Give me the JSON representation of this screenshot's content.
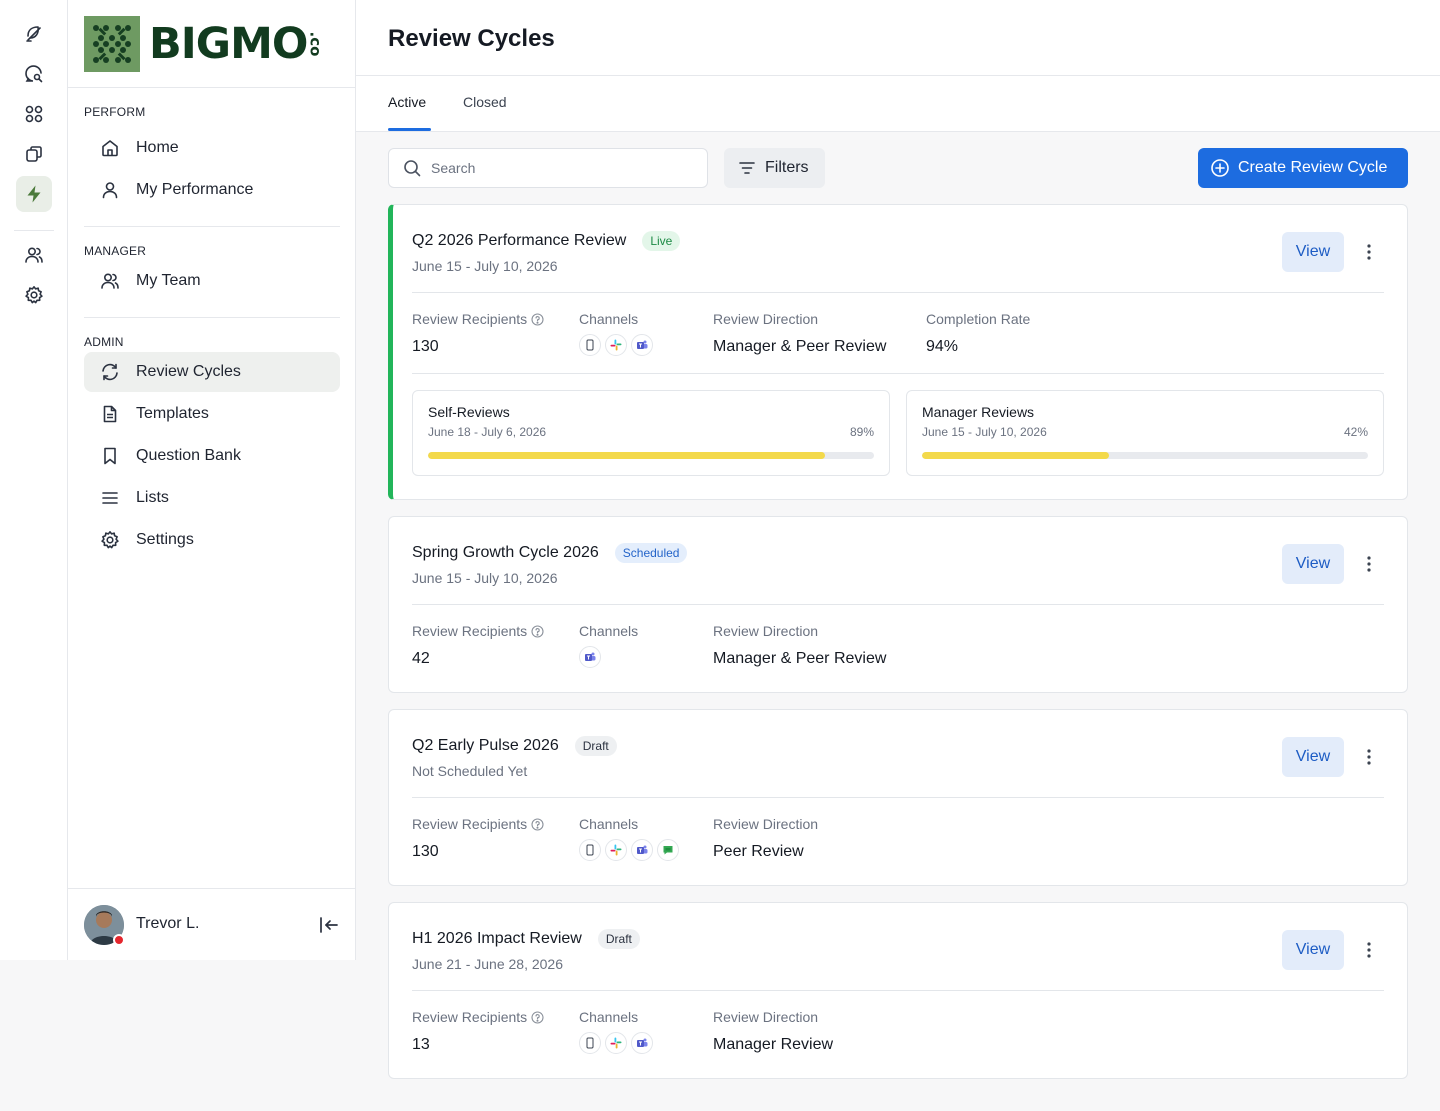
{
  "brand": {
    "name": "BIGMO",
    "suffix": ".co"
  },
  "sidebar": {
    "sections": [
      {
        "label": "PERFORM",
        "items": [
          {
            "label": "Home",
            "icon": "home-icon"
          },
          {
            "label": "My Performance",
            "icon": "user-icon"
          }
        ]
      },
      {
        "label": "MANAGER",
        "items": [
          {
            "label": "My Team",
            "icon": "users-icon"
          }
        ]
      },
      {
        "label": "ADMIN",
        "items": [
          {
            "label": "Review Cycles",
            "icon": "refresh-icon",
            "active": true
          },
          {
            "label": "Templates",
            "icon": "document-icon"
          },
          {
            "label": "Question Bank",
            "icon": "bookmark-icon"
          },
          {
            "label": "Lists",
            "icon": "list-icon"
          },
          {
            "label": "Settings",
            "icon": "gear-icon"
          }
        ]
      }
    ],
    "user": {
      "name": "Trevor L.",
      "status_color": "#e5262d"
    }
  },
  "header": {
    "title": "Review Cycles",
    "tabs": [
      {
        "label": "Active",
        "active": true
      },
      {
        "label": "Closed",
        "active": false
      }
    ]
  },
  "toolbar": {
    "search_placeholder": "Search",
    "filters_label": "Filters",
    "create_label": "Create Review Cycle"
  },
  "colors": {
    "accent": "#1d6ce0",
    "live": "#22b55a",
    "brand_green": "#123b1f",
    "progress": "#f3d94b"
  },
  "cycles": [
    {
      "title": "Q2 2026 Performance Review",
      "status": "Live",
      "dates": "June 15 - July 10, 2026",
      "view_label": "View",
      "recipients_label": "Review Recipients",
      "recipients": "130",
      "channels_label": "Channels",
      "channels": [
        "mobile",
        "slack",
        "teams"
      ],
      "direction_label": "Review Direction",
      "direction": "Manager & Peer Review",
      "completion_label": "Completion Rate",
      "completion": "94%",
      "phases": [
        {
          "title": "Self-Reviews",
          "dates": "June 18 - July 6, 2026",
          "percent_label": "89%",
          "progress": 0.89
        },
        {
          "title": "Manager Reviews",
          "dates": "June 15 - July 10, 2026",
          "percent_label": "42%",
          "progress": 0.42
        }
      ]
    },
    {
      "title": "Spring Growth Cycle 2026",
      "status": "Scheduled",
      "dates": "June 15 - July 10, 2026",
      "view_label": "View",
      "recipients_label": "Review Recipients",
      "recipients": "42",
      "channels_label": "Channels",
      "channels": [
        "teams"
      ],
      "direction_label": "Review Direction",
      "direction": "Manager & Peer Review"
    },
    {
      "title": "Q2 Early Pulse 2026",
      "status": "Draft",
      "dates": "Not Scheduled Yet",
      "view_label": "View",
      "recipients_label": "Review Recipients",
      "recipients": "130",
      "channels_label": "Channels",
      "channels": [
        "mobile",
        "slack",
        "teams",
        "google-chat"
      ],
      "direction_label": "Review Direction",
      "direction": "Peer Review"
    },
    {
      "title": "H1 2026 Impact Review",
      "status": "Draft",
      "dates": "June 21 - June 28, 2026",
      "view_label": "View",
      "recipients_label": "Review Recipients",
      "recipients": "13",
      "channels_label": "Channels",
      "channels": [
        "mobile",
        "slack",
        "teams"
      ],
      "direction_label": "Review Direction",
      "direction": "Manager Review"
    }
  ]
}
